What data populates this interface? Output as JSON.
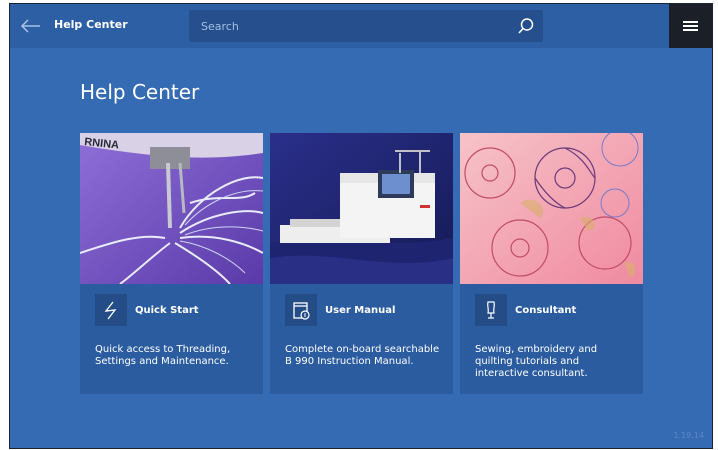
{
  "topbar": {
    "title": "Help Center"
  },
  "search": {
    "placeholder": "Search"
  },
  "page": {
    "title": "Help Center"
  },
  "cards": [
    {
      "title": "Quick Start",
      "icon": "lightning-icon",
      "description": "Quick access to Threading, Settings and Maintenance."
    },
    {
      "title": "User Manual",
      "icon": "manual-book-icon",
      "description": "Complete on-board searchable B 990 Instruction Manual."
    },
    {
      "title": "Consultant",
      "icon": "dress-form-icon",
      "description": "Sewing, embroidery and quilting tutorials and interactive consultant."
    }
  ],
  "images": {
    "machine_brand_text": "RNINA"
  },
  "version": "1.19.14",
  "colors": {
    "background": "#356bb3",
    "topbar": "#2d5fa4",
    "card": "#2b5c9f",
    "menu": "#1b1f28"
  }
}
